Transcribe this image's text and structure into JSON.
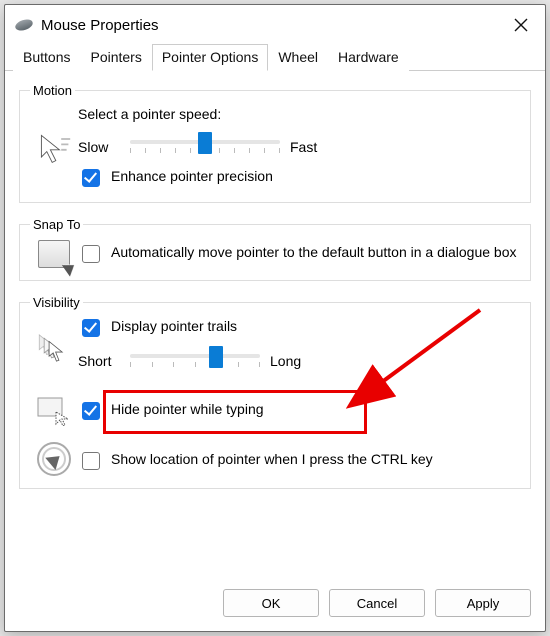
{
  "title": "Mouse Properties",
  "tabs": [
    "Buttons",
    "Pointers",
    "Pointer Options",
    "Wheel",
    "Hardware"
  ],
  "active_tab": 2,
  "motion": {
    "legend": "Motion",
    "speed_label": "Select a pointer speed:",
    "slow": "Slow",
    "fast": "Fast",
    "speed_percent": 50,
    "enhance_label": "Enhance pointer precision",
    "enhance_checked": true
  },
  "snap": {
    "legend": "Snap To",
    "auto_label": "Automatically move pointer to the default button in a dialogue box",
    "auto_checked": false
  },
  "visibility": {
    "legend": "Visibility",
    "trails_label": "Display pointer trails",
    "trails_checked": true,
    "short": "Short",
    "long": "Long",
    "trails_percent": 66,
    "hide_label": "Hide pointer while typing",
    "hide_checked": true,
    "ctrl_label": "Show location of pointer when I press the CTRL key",
    "ctrl_checked": false
  },
  "buttons": {
    "ok": "OK",
    "cancel": "Cancel",
    "apply": "Apply"
  }
}
